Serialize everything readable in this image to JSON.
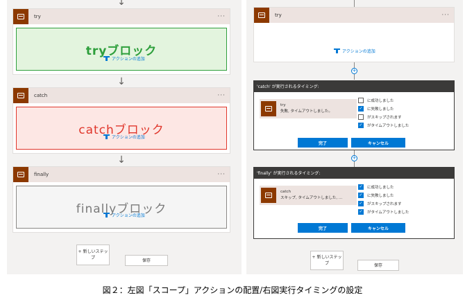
{
  "left": {
    "scopes": [
      {
        "name": "try",
        "block_label": "tryブロック",
        "add_action": "アクションの追加"
      },
      {
        "name": "catch",
        "block_label": "catchブロック",
        "add_action": "アクションの追加"
      },
      {
        "name": "finally",
        "block_label": "finallyブロック",
        "add_action": "アクションの追加"
      }
    ],
    "more_menu": "···",
    "arrow_glyph": "↓",
    "new_step_label": "+ 新しいステップ",
    "save_label": "保存"
  },
  "right": {
    "top_scope": {
      "name": "try",
      "add_action": "アクションの追加"
    },
    "more_menu": "···",
    "dialogs": [
      {
        "title": "'catch' が実行されるタイミング:",
        "card_name": "try",
        "card_status": "失敗, タイムアウトしました。",
        "options": [
          {
            "label": "に成功しました",
            "checked": false
          },
          {
            "label": "に失敗しました",
            "checked": true
          },
          {
            "label": "がスキップされます",
            "checked": false
          },
          {
            "label": "がタイムアウトしました",
            "checked": true
          }
        ],
        "done_label": "完了",
        "cancel_label": "キャンセル"
      },
      {
        "title": "'finally' が実行されるタイミング:",
        "card_name": "catch",
        "card_status": "スキップ, タイムアウトしました, …",
        "options": [
          {
            "label": "に成功しました",
            "checked": true
          },
          {
            "label": "に失敗しました",
            "checked": true
          },
          {
            "label": "がスキップされます",
            "checked": true
          },
          {
            "label": "がタイムアウトしました",
            "checked": true
          }
        ],
        "done_label": "完了",
        "cancel_label": "キャンセル"
      }
    ],
    "new_step_label": "+ 新しいステップ",
    "save_label": "保存"
  },
  "caption": "図２：左図「スコープ」アクションの配置/右図実行タイミングの設定",
  "colors": {
    "try_border": "#2e9f3c",
    "try_fill": "#e3f4de",
    "try_text": "#2e9f3c",
    "catch_border": "#e0362b",
    "catch_fill": "#fde7e4",
    "catch_text": "#e0362b",
    "finally_border": "#8a8886",
    "finally_fill": "#f5f5f5",
    "finally_text": "#7a7a7a",
    "scope_icon": "#8c3900",
    "accent": "#0078d4"
  }
}
